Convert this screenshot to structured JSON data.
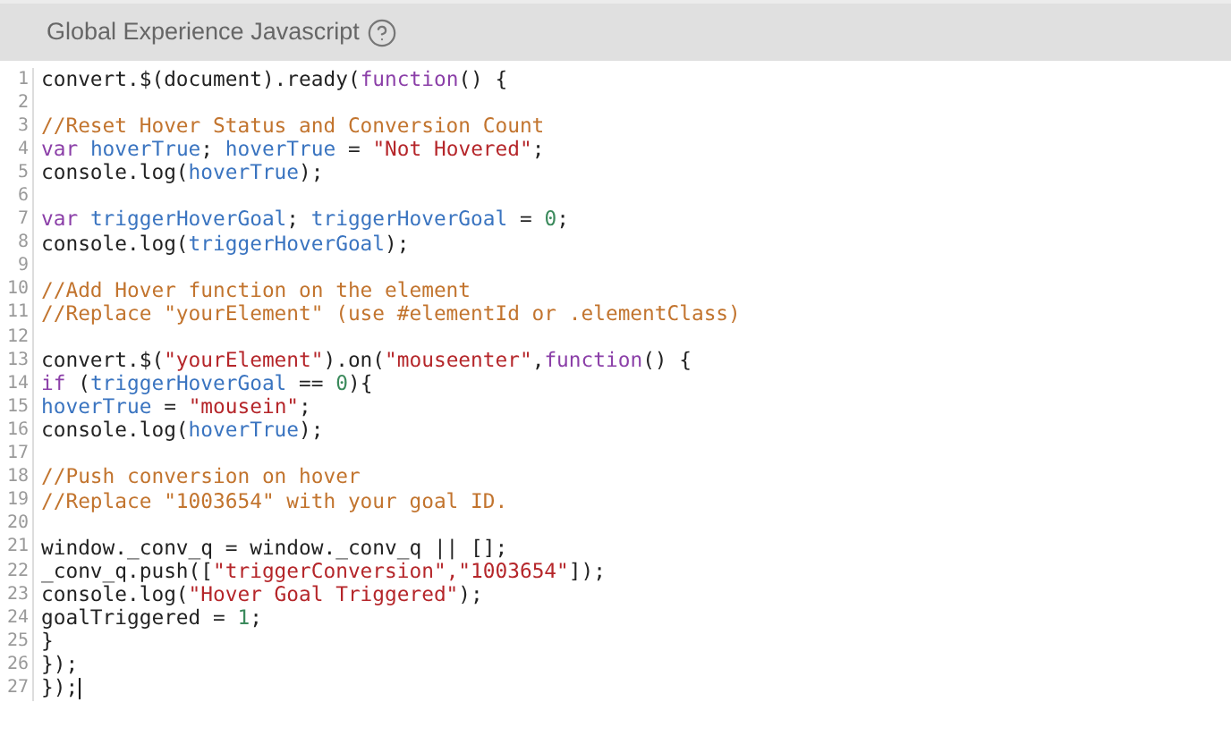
{
  "panel": {
    "title": "Global Experience Javascript"
  },
  "editor": {
    "cursor_at_end": true,
    "lines": [
      {
        "number": "1",
        "tokens": [
          {
            "kind": "plain",
            "text": "convert.$(document).ready("
          },
          {
            "kind": "keyword",
            "text": "function"
          },
          {
            "kind": "plain",
            "text": "() {"
          }
        ]
      },
      {
        "number": "2"
      },
      {
        "number": "3",
        "tokens": [
          {
            "kind": "comment",
            "text": "//Reset Hover Status and Conversion Count"
          }
        ]
      },
      {
        "number": "4",
        "tokens": [
          {
            "kind": "keyword",
            "text": "var "
          },
          {
            "kind": "variable",
            "text": "hoverTrue"
          },
          {
            "kind": "plain",
            "text": "; "
          },
          {
            "kind": "variable",
            "text": "hoverTrue"
          },
          {
            "kind": "plain",
            "text": " = "
          },
          {
            "kind": "string",
            "text": "\"Not Hovered\""
          },
          {
            "kind": "plain",
            "text": ";"
          }
        ]
      },
      {
        "number": "5",
        "tokens": [
          {
            "kind": "plain",
            "text": "console.log("
          },
          {
            "kind": "variable",
            "text": "hoverTrue"
          },
          {
            "kind": "plain",
            "text": ");"
          }
        ]
      },
      {
        "number": "6"
      },
      {
        "number": "7",
        "tokens": [
          {
            "kind": "keyword",
            "text": "var "
          },
          {
            "kind": "variable",
            "text": "triggerHoverGoal"
          },
          {
            "kind": "plain",
            "text": "; "
          },
          {
            "kind": "variable",
            "text": "triggerHoverGoal"
          },
          {
            "kind": "plain",
            "text": " = "
          },
          {
            "kind": "number",
            "text": "0"
          },
          {
            "kind": "plain",
            "text": ";"
          }
        ]
      },
      {
        "number": "8",
        "tokens": [
          {
            "kind": "plain",
            "text": "console.log("
          },
          {
            "kind": "variable",
            "text": "triggerHoverGoal"
          },
          {
            "kind": "plain",
            "text": ");"
          }
        ]
      },
      {
        "number": "9"
      },
      {
        "number": "10",
        "tokens": [
          {
            "kind": "comment",
            "text": "//Add Hover function on the element"
          }
        ]
      },
      {
        "number": "11",
        "tokens": [
          {
            "kind": "comment",
            "text": "//Replace \"yourElement\" (use #elementId or .elementClass)"
          }
        ]
      },
      {
        "number": "12"
      },
      {
        "number": "13",
        "tokens": [
          {
            "kind": "plain",
            "text": "convert.$("
          },
          {
            "kind": "string",
            "text": "\"yourElement\""
          },
          {
            "kind": "plain",
            "text": ").on("
          },
          {
            "kind": "string",
            "text": "\"mouseenter\""
          },
          {
            "kind": "plain",
            "text": ","
          },
          {
            "kind": "keyword",
            "text": "function"
          },
          {
            "kind": "plain",
            "text": "() {"
          }
        ]
      },
      {
        "number": "14",
        "tokens": [
          {
            "kind": "keyword",
            "text": "if"
          },
          {
            "kind": "plain",
            "text": " ("
          },
          {
            "kind": "variable",
            "text": "triggerHoverGoal"
          },
          {
            "kind": "plain",
            "text": " == "
          },
          {
            "kind": "number",
            "text": "0"
          },
          {
            "kind": "plain",
            "text": "){"
          }
        ]
      },
      {
        "number": "15",
        "tokens": [
          {
            "kind": "variable",
            "text": "hoverTrue"
          },
          {
            "kind": "plain",
            "text": " = "
          },
          {
            "kind": "string",
            "text": "\"mousein\""
          },
          {
            "kind": "plain",
            "text": ";"
          }
        ]
      },
      {
        "number": "16",
        "tokens": [
          {
            "kind": "plain",
            "text": "console.log("
          },
          {
            "kind": "variable",
            "text": "hoverTrue"
          },
          {
            "kind": "plain",
            "text": ");"
          }
        ]
      },
      {
        "number": "17"
      },
      {
        "number": "18",
        "tokens": [
          {
            "kind": "comment",
            "text": "//Push conversion on hover"
          }
        ]
      },
      {
        "number": "19",
        "tokens": [
          {
            "kind": "comment",
            "text": "//Replace \"1003654\" with your goal ID."
          }
        ]
      },
      {
        "number": "20"
      },
      {
        "number": "21",
        "tokens": [
          {
            "kind": "plain",
            "text": "window._conv_q = window._conv_q || [];"
          }
        ]
      },
      {
        "number": "22",
        "tokens": [
          {
            "kind": "plain",
            "text": "_conv_q.push(["
          },
          {
            "kind": "string",
            "text": "\"triggerConversion\",\"1003654\""
          },
          {
            "kind": "plain",
            "text": "]);"
          }
        ]
      },
      {
        "number": "23",
        "tokens": [
          {
            "kind": "plain",
            "text": "console.log("
          },
          {
            "kind": "string",
            "text": "\"Hover Goal Triggered\""
          },
          {
            "kind": "plain",
            "text": ");"
          }
        ]
      },
      {
        "number": "24",
        "tokens": [
          {
            "kind": "plain",
            "text": "goalTriggered = "
          },
          {
            "kind": "number",
            "text": "1"
          },
          {
            "kind": "plain",
            "text": ";"
          }
        ]
      },
      {
        "number": "25",
        "tokens": [
          {
            "kind": "plain",
            "text": "}"
          }
        ]
      },
      {
        "number": "26",
        "tokens": [
          {
            "kind": "plain",
            "text": "});"
          }
        ]
      },
      {
        "number": "27",
        "tokens": [
          {
            "kind": "plain",
            "text": "});"
          }
        ]
      }
    ]
  }
}
